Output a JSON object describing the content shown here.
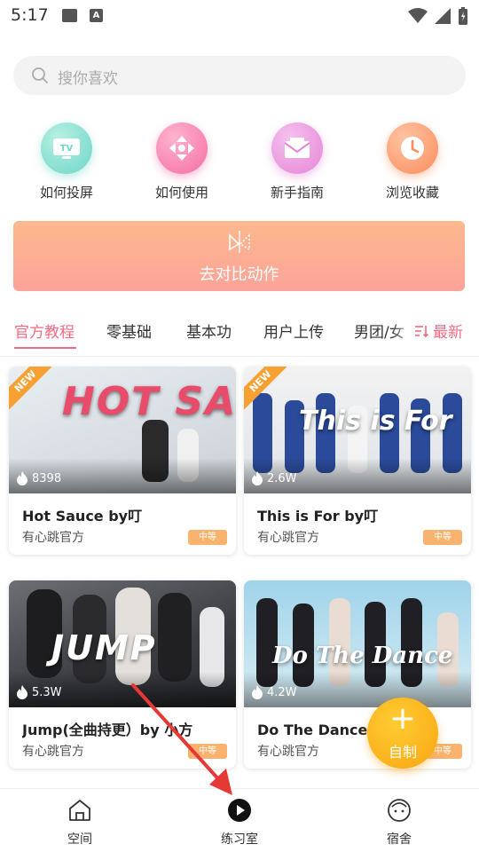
{
  "status_bar": {
    "time": "5:17"
  },
  "search": {
    "placeholder": "搜你喜欢"
  },
  "quick_actions": [
    {
      "label": "如何投屏",
      "icon": "tv-icon",
      "color": "#6fd6c8"
    },
    {
      "label": "如何使用",
      "icon": "dpad-icon",
      "color": "#f46ea2"
    },
    {
      "label": "新手指南",
      "icon": "mail-icon",
      "color": "#e686d6"
    },
    {
      "label": "浏览收藏",
      "icon": "clock-icon",
      "color": "#fb8d5c"
    }
  ],
  "action_banner": {
    "label": "去对比动作"
  },
  "tabs": {
    "items": [
      "官方教程",
      "零基础",
      "基本功",
      "用户上传",
      "男团/女"
    ],
    "sort_label": "最新"
  },
  "cards": [
    {
      "title": "Hot Sauce by叮",
      "author": "有心跳官方",
      "views": "8398",
      "level": "中等",
      "is_new": true,
      "new_label": "NEW",
      "art_text": "HOT SAUCE"
    },
    {
      "title": "This is For by叮",
      "author": "有心跳官方",
      "views": "2.6W",
      "level": "中等",
      "is_new": true,
      "new_label": "NEW",
      "art_text": "This is For"
    },
    {
      "title": "Jump(全曲持更）by 小方",
      "author": "有心跳官方",
      "views": "5.3W",
      "level": "中等",
      "is_new": false,
      "art_text": "JUMP"
    },
    {
      "title": "Do The Dance（...",
      "author": "有心跳官方",
      "views": "4.2W",
      "level": "中等",
      "is_new": false,
      "art_text": "Do The Dance"
    }
  ],
  "fab": {
    "plus": "+",
    "label": "自制"
  },
  "bottom_nav": [
    {
      "label": "空间",
      "icon": "home-icon"
    },
    {
      "label": "练习室",
      "icon": "play-icon"
    },
    {
      "label": "宿舍",
      "icon": "face-icon"
    }
  ],
  "colors": {
    "accent": "#f36b82",
    "fab": "#f9a512",
    "banner": "#fcb98d",
    "annotation": "#e53935"
  }
}
